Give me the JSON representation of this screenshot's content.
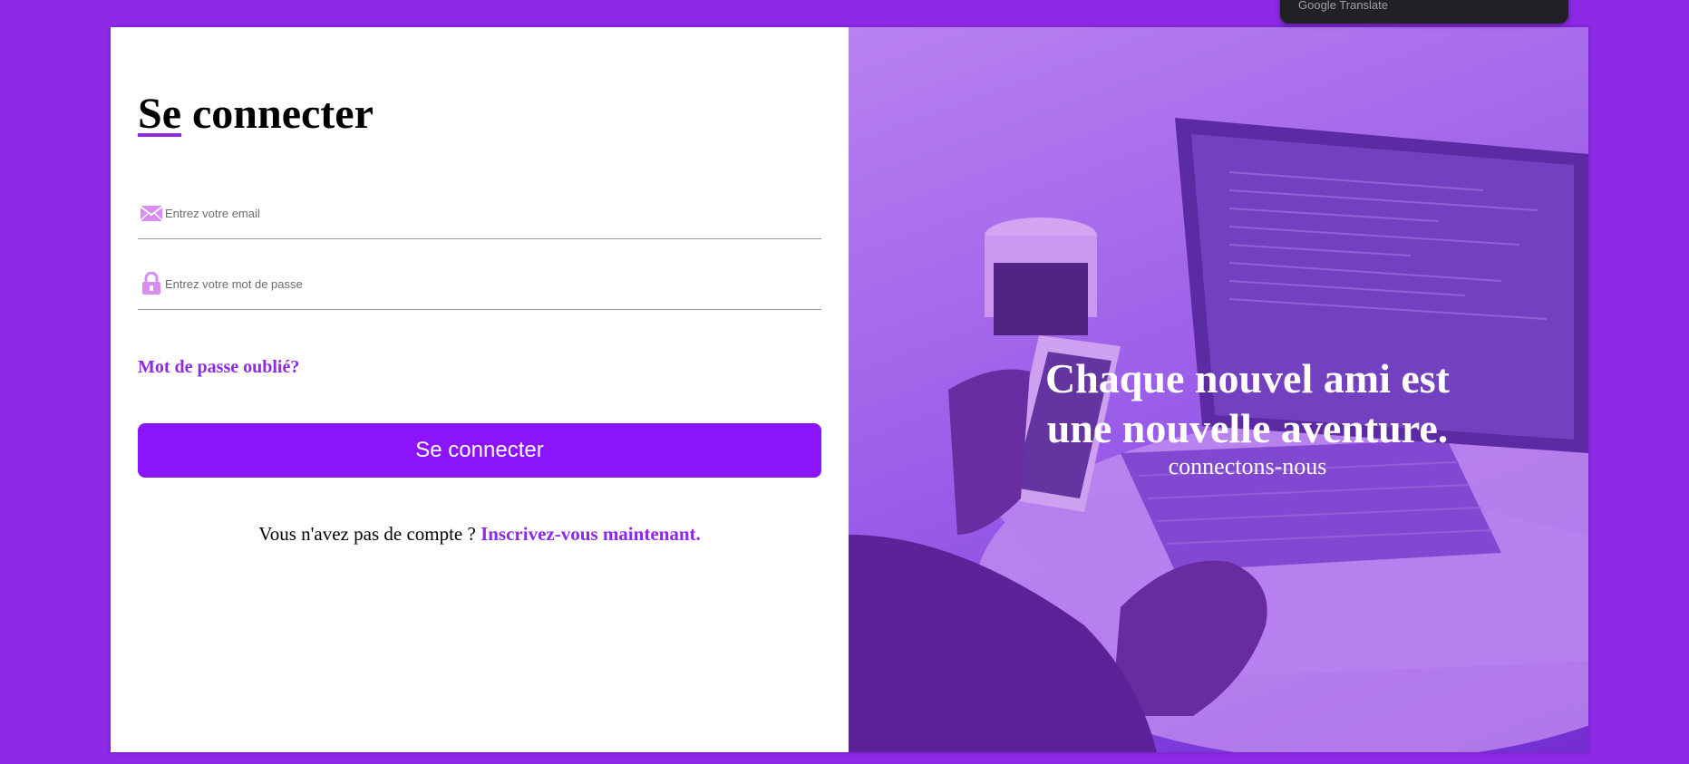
{
  "translate_popup": {
    "label": "Google Translate"
  },
  "login": {
    "title_first_word": "Se",
    "title_rest": " connecter",
    "email_placeholder": "Entrez votre email",
    "email_icon": "envelope-icon",
    "password_placeholder": "Entrez votre mot de passe",
    "password_icon": "lock-icon",
    "forgot_password": "Mot de passe oublié?",
    "submit_label": "Se connecter",
    "no_account_text": "Vous n'avez pas de compte ? ",
    "signup_link": "Inscrivez-vous maintenant."
  },
  "hero": {
    "headline": "Chaque nouvel ami est une nouvelle aventure.",
    "subline": "connectons-nous"
  },
  "colors": {
    "page_background": "#8c2ae6",
    "accent": "#8c2ae6",
    "button": "#8c14fc",
    "icon": "#d78ef0"
  }
}
